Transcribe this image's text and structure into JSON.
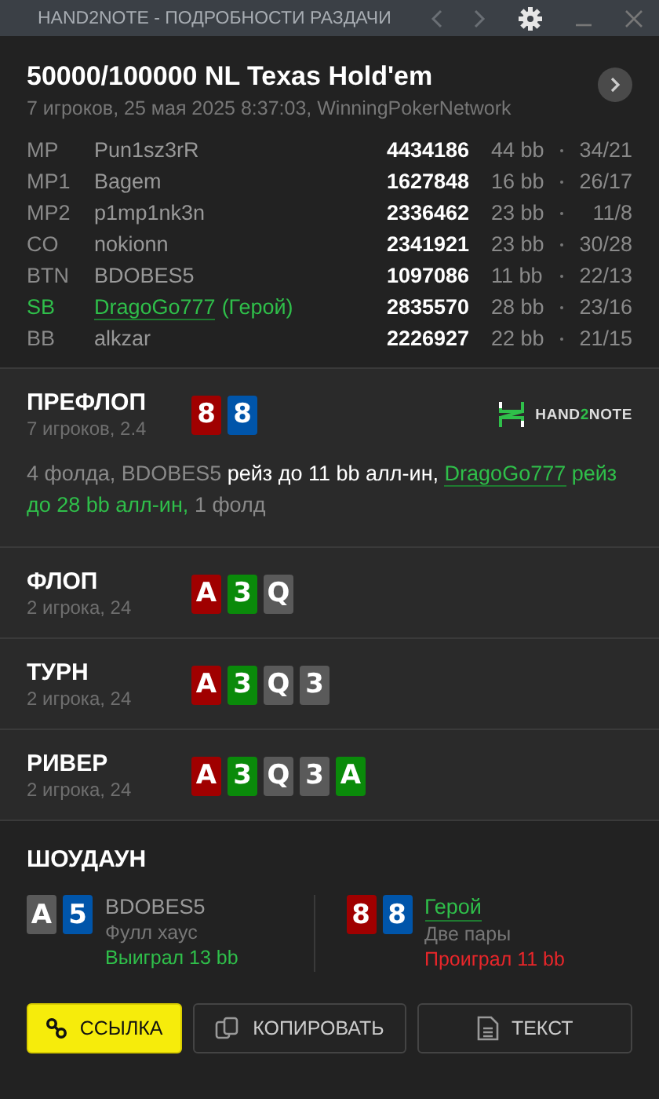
{
  "window": {
    "title": "HAND2NOTE - ПОДРОБНОСТИ РАЗДАЧИ",
    "back_disabled": true,
    "forward_disabled": true
  },
  "header": {
    "title": "50000/100000 NL Texas Hold'em",
    "subtitle": "7 игроков, 25 мая 2025 8:37:03, WinningPokerNetwork"
  },
  "players": [
    {
      "position": "MP",
      "name": "Pun1sz3rR",
      "hero": false,
      "stack": "4434186",
      "bb": "44 bb",
      "stats": "34/21"
    },
    {
      "position": "MP1",
      "name": "Bagem",
      "hero": false,
      "stack": "1627848",
      "bb": "16 bb",
      "stats": "26/17"
    },
    {
      "position": "MP2",
      "name": "p1mp1nk3n",
      "hero": false,
      "stack": "2336462",
      "bb": "23 bb",
      "stats": "11/8"
    },
    {
      "position": "CO",
      "name": "nokionn",
      "hero": false,
      "stack": "2341921",
      "bb": "23 bb",
      "stats": "30/28"
    },
    {
      "position": "BTN",
      "name": "BDOBES5",
      "hero": false,
      "stack": "1097086",
      "bb": "11 bb",
      "stats": "22/13"
    },
    {
      "position": "SB",
      "name": "DragoGo777",
      "hero": true,
      "hero_label": "(Герой)",
      "stack": "2835570",
      "bb": "28 bb",
      "stats": "23/16"
    },
    {
      "position": "BB",
      "name": "alkzar",
      "hero": false,
      "stack": "2226927",
      "bb": "22 bb",
      "stats": "21/15"
    }
  ],
  "streets": [
    {
      "title": "ПРЕФЛОП",
      "subtitle": "7 игроков, 2.4",
      "cards": [
        {
          "rank": "8",
          "color": "#a00000"
        },
        {
          "rank": "8",
          "color": "#0055aa"
        }
      ],
      "logo": [
        {
          "text": "HAND",
          "accent": false
        },
        {
          "text": "2",
          "accent": true
        },
        {
          "text": "NOTE",
          "accent": false
        }
      ],
      "actions": [
        {
          "kind": "muted",
          "text": "4 фолда, BDOBES5 "
        },
        {
          "kind": "bright",
          "text": "рейз до 11 bb алл-ин, "
        },
        {
          "kind": "link",
          "text": "DragoGo777"
        },
        {
          "kind": "hero",
          "text": " рейз до 28 bb алл-ин,"
        },
        {
          "kind": "muted",
          "text": " 1 фолд"
        }
      ]
    },
    {
      "title": "ФЛОП",
      "subtitle": "2 игрока, 24",
      "cards": [
        {
          "rank": "A",
          "color": "#a00000"
        },
        {
          "rank": "3",
          "color": "#0a8a0a"
        },
        {
          "rank": "Q",
          "color": "#5a5a5a"
        }
      ]
    },
    {
      "title": "ТУРН",
      "subtitle": "2 игрока, 24",
      "cards": [
        {
          "rank": "A",
          "color": "#a00000"
        },
        {
          "rank": "3",
          "color": "#0a8a0a"
        },
        {
          "rank": "Q",
          "color": "#5a5a5a"
        },
        {
          "rank": "3",
          "color": "#5a5a5a"
        }
      ]
    },
    {
      "title": "РИВЕР",
      "subtitle": "2 игрока, 24",
      "cards": [
        {
          "rank": "A",
          "color": "#a00000"
        },
        {
          "rank": "3",
          "color": "#0a8a0a"
        },
        {
          "rank": "Q",
          "color": "#5a5a5a"
        },
        {
          "rank": "3",
          "color": "#5a5a5a"
        },
        {
          "rank": "A",
          "color": "#0a8a0a"
        }
      ]
    }
  ],
  "showdown": {
    "title": "ШОУДАУН",
    "hands": [
      {
        "cards": [
          {
            "rank": "A",
            "color": "#5a5a5a"
          },
          {
            "rank": "5",
            "color": "#0055aa"
          }
        ],
        "name": "BDOBES5",
        "hero": false,
        "combo": "Фулл хаус",
        "result": "Выиграл 13 bb",
        "won": true
      },
      {
        "cards": [
          {
            "rank": "8",
            "color": "#a00000"
          },
          {
            "rank": "8",
            "color": "#0055aa"
          }
        ],
        "name": "Герой",
        "hero": true,
        "combo": "Две пары",
        "result": "Проиграл 11 bb",
        "won": false
      }
    ]
  },
  "buttons": [
    {
      "kind": "link",
      "label": "ССЫЛКА",
      "primary": true
    },
    {
      "kind": "copy",
      "label": "КОПИРОВАТЬ",
      "primary": false
    },
    {
      "kind": "text",
      "label": "ТЕКСТ",
      "primary": false
    }
  ]
}
